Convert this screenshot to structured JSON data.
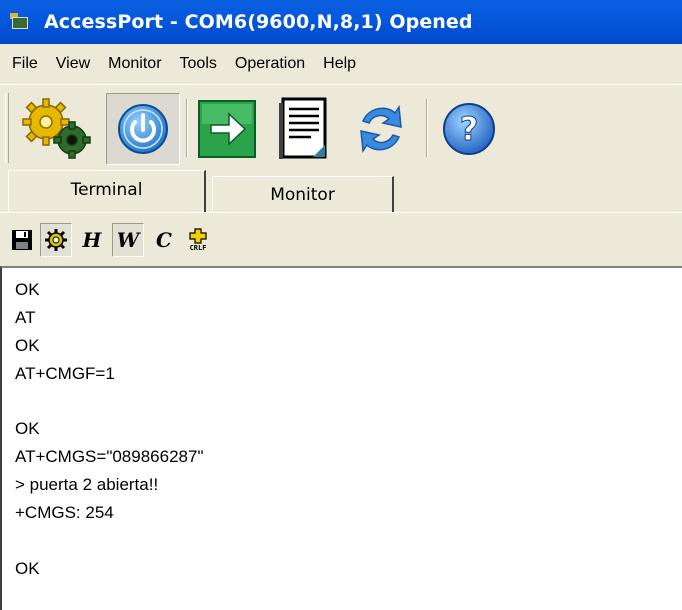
{
  "window": {
    "title": "AccessPort - COM6(9600,N,8,1) Opened"
  },
  "menu": [
    "File",
    "View",
    "Monitor",
    "Tools",
    "Operation",
    "Help"
  ],
  "toolbar": {
    "buttons": [
      "gears-icon",
      "power-icon",
      "green-arrow-icon",
      "document-icon",
      "refresh-arrows-icon",
      "help-icon"
    ]
  },
  "tabs": {
    "terminal": "Terminal",
    "monitor": "Monitor"
  },
  "subtoolbar": {
    "h": "H",
    "w": "W",
    "c": "C",
    "crlf": "CRLF"
  },
  "terminal": {
    "lines": [
      "OK",
      "AT",
      "OK",
      "AT+CMGF=1",
      "",
      "OK",
      "AT+CMGS=\"089866287\"",
      "> puerta 2 abierta!!",
      "+CMGS: 254",
      "",
      "OK"
    ]
  },
  "colors": {
    "titlebar": "#0458dc",
    "chrome": "#ece9d8",
    "terminal_bg": "#ffffff"
  }
}
